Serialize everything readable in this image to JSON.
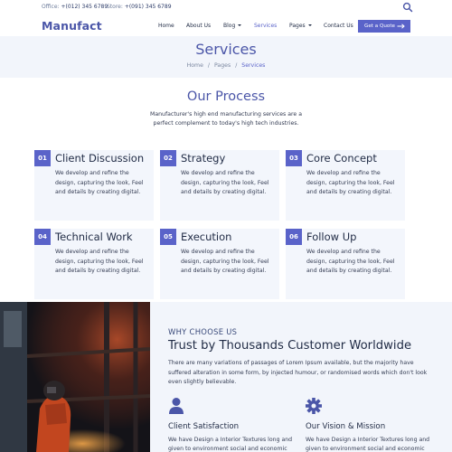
{
  "topbar": {
    "office_label": "Office:",
    "office_phone": "+(012) 345 6789",
    "store_label": "Store:",
    "store_phone": "+(091) 345 6789",
    "search_icon": "search-icon"
  },
  "nav": {
    "logo": "Manufact",
    "items": [
      "Home",
      "About Us",
      "Blog",
      "Services",
      "Pages",
      "Contact Us"
    ],
    "active": "Services",
    "quote_button": "Get a Quote",
    "accent": "#5a63c9"
  },
  "hero": {
    "title": "Services",
    "breadcrumb": [
      "Home",
      "Pages",
      "Services"
    ],
    "separator": "/"
  },
  "process": {
    "title": "Our Process",
    "subtitle": "Manufacturer's high end manufacturing services are a perfect complement to today's high tech industries.",
    "cards": [
      {
        "num": "01",
        "title": "Client Discussion",
        "text": "We develop and refine the design, capturing the look, Feel and details by creating digital."
      },
      {
        "num": "02",
        "title": "Strategy",
        "text": "We develop and refine the design, capturing the look, Feel and details by creating digital."
      },
      {
        "num": "03",
        "title": "Core Concept",
        "text": "We develop and refine the design, capturing the look, Feel and details by creating digital."
      },
      {
        "num": "04",
        "title": "Technical Work",
        "text": "We develop and refine the design, capturing the look, Feel and details by creating digital."
      },
      {
        "num": "05",
        "title": "Execution",
        "text": "We develop and refine the design, capturing the look, Feel and details by creating digital."
      },
      {
        "num": "06",
        "title": "Follow Up",
        "text": "We develop and refine the design, capturing the look, Feel and details by creating digital."
      }
    ]
  },
  "why": {
    "label": "WHY CHOOSE US",
    "title": "Trust by Thousands Customer Worldwide",
    "text": "There are many variations of passages of Lorem Ipsum available, but the majority have suffered alteration in some form, by injected humour, or randomised words which don't look even slightly believable.",
    "features": [
      {
        "icon": "user-icon",
        "title": "Client Satisfaction",
        "text": "We have Design a Interior Textures long and given to environment social and economic"
      },
      {
        "icon": "gear-icon",
        "title": "Our Vision & Mission",
        "text": "We have Design a Interior Textures long and given to environment social and economic"
      }
    ]
  }
}
